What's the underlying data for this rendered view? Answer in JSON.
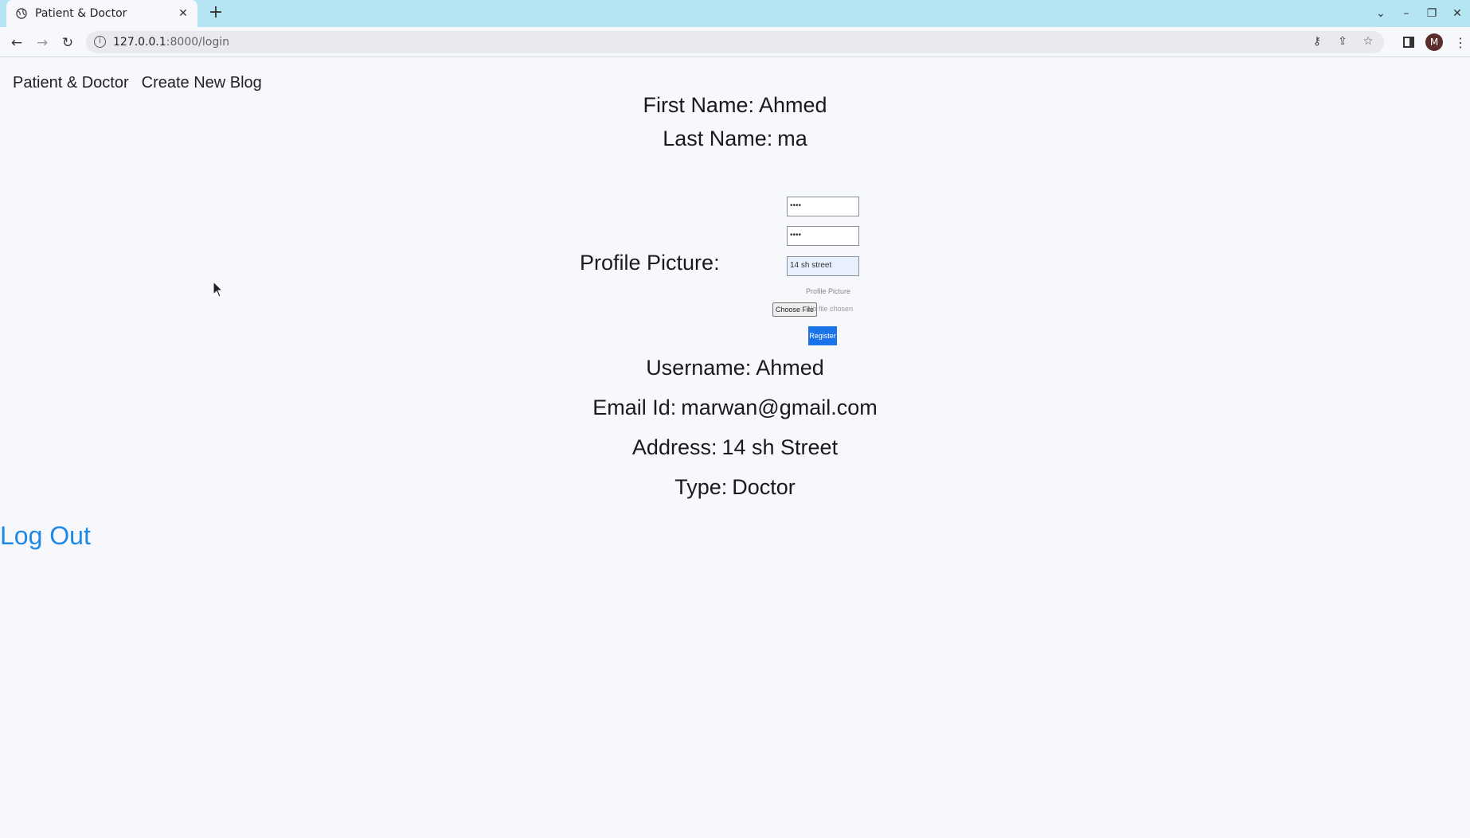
{
  "browser": {
    "tab_title": "Patient & Doctor",
    "url_host": "127.0.0.1",
    "url_path": ":8000/login",
    "profile_initial": "M"
  },
  "nav": {
    "brand": "Patient & Doctor",
    "create_blog": "Create New Blog"
  },
  "profile": {
    "first_name_label": "First Name:",
    "first_name": "Ahmed",
    "last_name_label": "Last Name:",
    "last_name": "ma",
    "picture_label": "Profile Picture:",
    "username_label": "Username:",
    "username": "Ahmed",
    "email_label": "Email Id:",
    "email": "marwan@gmail.com",
    "address_label": "Address:",
    "address": "14 sh Street",
    "type_label": "Type:",
    "type": "Doctor"
  },
  "embedded_form": {
    "field1_value": "••••",
    "field2_value": "••••",
    "address_value": "14 sh street",
    "picture_caption": "Profile Picture",
    "choose_file": "Choose File",
    "no_file": "No file chosen",
    "register": "Register"
  },
  "logout": "Log Out"
}
